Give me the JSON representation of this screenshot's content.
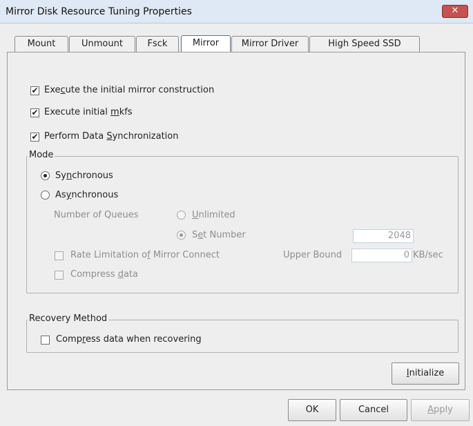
{
  "window": {
    "title": "Mirror Disk Resource Tuning Properties",
    "close_glyph": "✕"
  },
  "tabs": [
    {
      "label": "Mount"
    },
    {
      "label": "Unmount"
    },
    {
      "label": "Fsck"
    },
    {
      "label": "Mirror",
      "active": true
    },
    {
      "label": "Mirror Driver"
    },
    {
      "label": "High Speed SSD"
    }
  ],
  "options": {
    "initial_mirror": {
      "pre": "Exe",
      "u": "c",
      "post": "ute the initial mirror construction",
      "checked": true
    },
    "initial_mkfs": {
      "pre": "Execute initial ",
      "u": "m",
      "post": "kfs",
      "checked": true
    },
    "data_sync": {
      "pre": "Perform Data ",
      "u": "S",
      "post": "ynchronization",
      "checked": true
    }
  },
  "mode": {
    "legend": "Mode",
    "synchronous": {
      "pre": "Sy",
      "u": "n",
      "post": "chronous",
      "selected": true
    },
    "asynchronous": {
      "pre": "As",
      "u": "y",
      "post": "nchronous",
      "selected": false
    },
    "queues_label": "Number of Queues",
    "unlimited": {
      "pre": "",
      "u": "U",
      "post": "nlimited",
      "selected": false
    },
    "set_number": {
      "pre": "S",
      "u": "e",
      "post": "t Number",
      "selected": true
    },
    "queue_value": "2048",
    "rate_limit": {
      "pre": "Rate Limitation o",
      "u": "f",
      "post": " Mirror Connect",
      "checked": false
    },
    "upper_bound_label": "Upper Bound",
    "upper_bound_value": "0",
    "upper_bound_unit": "KB/sec",
    "compress": {
      "pre": "Compress ",
      "u": "d",
      "post": "ata",
      "checked": false
    }
  },
  "recovery": {
    "legend": "Recovery Method",
    "compress": {
      "pre": "Comp",
      "u": "r",
      "post": "ess data when recovering",
      "checked": false
    }
  },
  "buttons": {
    "initialize": {
      "pre": "",
      "u": "I",
      "post": "nitialize"
    },
    "ok": "OK",
    "cancel": "Cancel",
    "apply": {
      "pre": "",
      "u": "A",
      "post": "pply"
    }
  },
  "check_glyph": "✔",
  "colors": {
    "titlebar": "#dfe9f5",
    "close_button": "#c75050",
    "disabled_text": "#8e8e8e"
  }
}
